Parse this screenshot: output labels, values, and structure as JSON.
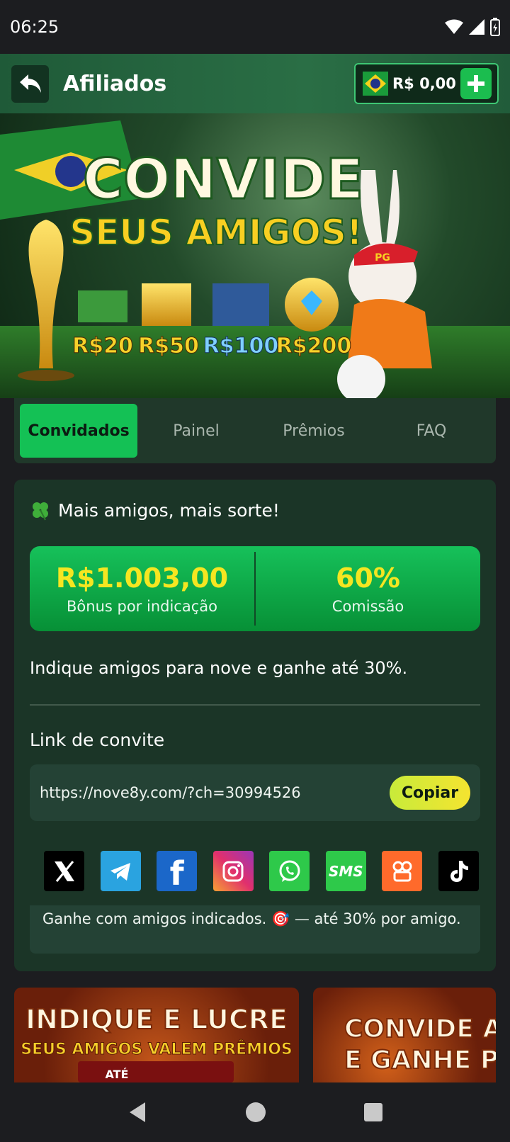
{
  "status": {
    "time": "06:25"
  },
  "header": {
    "title": "Afiliados",
    "balance": "R$ 0,00"
  },
  "banner": {
    "headline_1": "CONVIDE",
    "headline_2": "SEUS AMIGOS!",
    "tiers": [
      "R$20",
      "R$50",
      "R$100",
      "R$200"
    ],
    "cap_text": "PG"
  },
  "tabs": [
    {
      "label": "Convidados",
      "active": true
    },
    {
      "label": "Painel",
      "active": false
    },
    {
      "label": "Prêmios",
      "active": false
    },
    {
      "label": "FAQ",
      "active": false
    }
  ],
  "card": {
    "lead": "Mais amigos, mais sorte!",
    "bonus_value": "R$1.003,00",
    "bonus_label": "Bônus por indicação",
    "commission_value": "60%",
    "commission_label": "Comissão",
    "description": "Indique amigos para nove e ganhe até 30%.",
    "link_title": "Link de convite",
    "link_url": "https://nove8y.com/?ch=30994526",
    "copy_label": "Copiar",
    "socials": [
      {
        "name": "x-icon",
        "label": "X",
        "color": "#000000"
      },
      {
        "name": "telegram-icon",
        "label": "",
        "color": "#2aa3e0"
      },
      {
        "name": "facebook-icon",
        "label": "f",
        "color": "#1877f2"
      },
      {
        "name": "instagram-icon",
        "label": "",
        "color": "#e1306c"
      },
      {
        "name": "whatsapp-icon",
        "label": "",
        "color": "#25d366"
      },
      {
        "name": "sms-icon",
        "label": "SMS",
        "color": "#2ec94a"
      },
      {
        "name": "kwai-icon",
        "label": "",
        "color": "#ff6a2b"
      },
      {
        "name": "tiktok-icon",
        "label": "",
        "color": "#000000"
      }
    ],
    "note": "Ganhe com amigos indicados. 🎯 — até 30% por amigo."
  },
  "promos": [
    {
      "line_1": "INDIQUE E LUCRE",
      "line_2": "SEUS AMIGOS VALEM PRÊMIOS",
      "line_3": "ATÉ"
    },
    {
      "line_1": "CONVIDE AM",
      "line_2": "E GANHE PR"
    }
  ]
}
